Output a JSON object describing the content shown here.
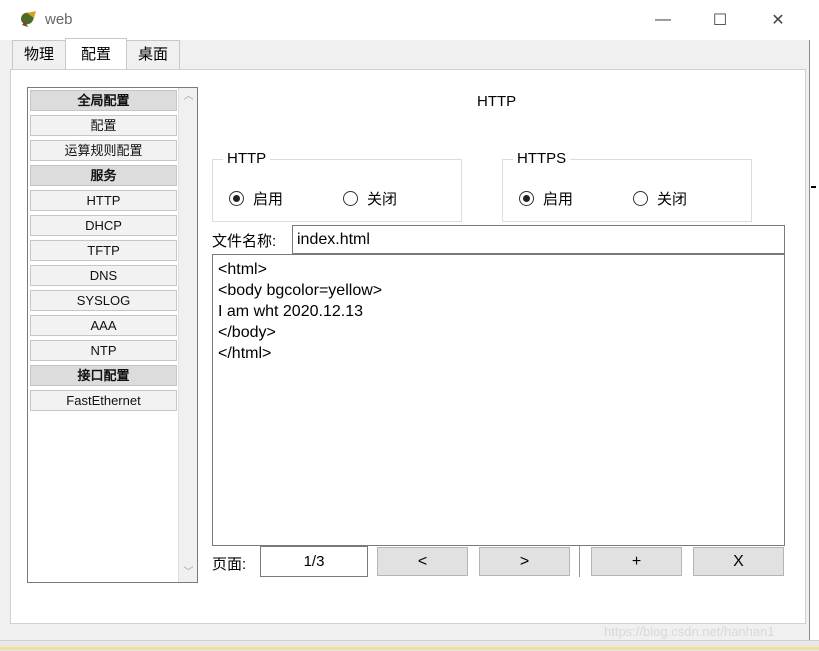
{
  "window": {
    "title": "web"
  },
  "window_controls": {
    "minimize": "—",
    "maximize": "☐",
    "close": "✕"
  },
  "tabs": [
    {
      "label": "物理",
      "active": false
    },
    {
      "label": "配置",
      "active": true
    },
    {
      "label": "桌面",
      "active": false
    }
  ],
  "sidebar": {
    "items": [
      {
        "label": "全局配置",
        "header": true
      },
      {
        "label": "配置",
        "header": false
      },
      {
        "label": "运算规则配置",
        "header": false
      },
      {
        "label": "服务",
        "header": true
      },
      {
        "label": "HTTP",
        "header": false
      },
      {
        "label": "DHCP",
        "header": false
      },
      {
        "label": "TFTP",
        "header": false
      },
      {
        "label": "DNS",
        "header": false
      },
      {
        "label": "SYSLOG",
        "header": false
      },
      {
        "label": "AAA",
        "header": false
      },
      {
        "label": "NTP",
        "header": false
      },
      {
        "label": "接口配置",
        "header": true
      },
      {
        "label": "FastEthernet",
        "header": false
      }
    ],
    "scroll_up": "︿",
    "scroll_down": "﹀"
  },
  "main": {
    "title": "HTTP",
    "http_group": {
      "legend": "HTTP",
      "on_label": "启用",
      "off_label": "关闭",
      "selected": "on"
    },
    "https_group": {
      "legend": "HTTPS",
      "on_label": "启用",
      "off_label": "关闭",
      "selected": "on"
    },
    "filename_label": "文件名称:",
    "filename_value": "index.html",
    "editor_content": "<html>\n<body bgcolor=yellow>\nI am wht 2020.12.13\n</body>\n</html>",
    "page_label": "页面:",
    "page_value": "1/3",
    "prev_label": "<",
    "next_label": ">",
    "add_label": "+",
    "delete_label": "X"
  },
  "watermark": "https://blog.csdn.net/hanhan1"
}
